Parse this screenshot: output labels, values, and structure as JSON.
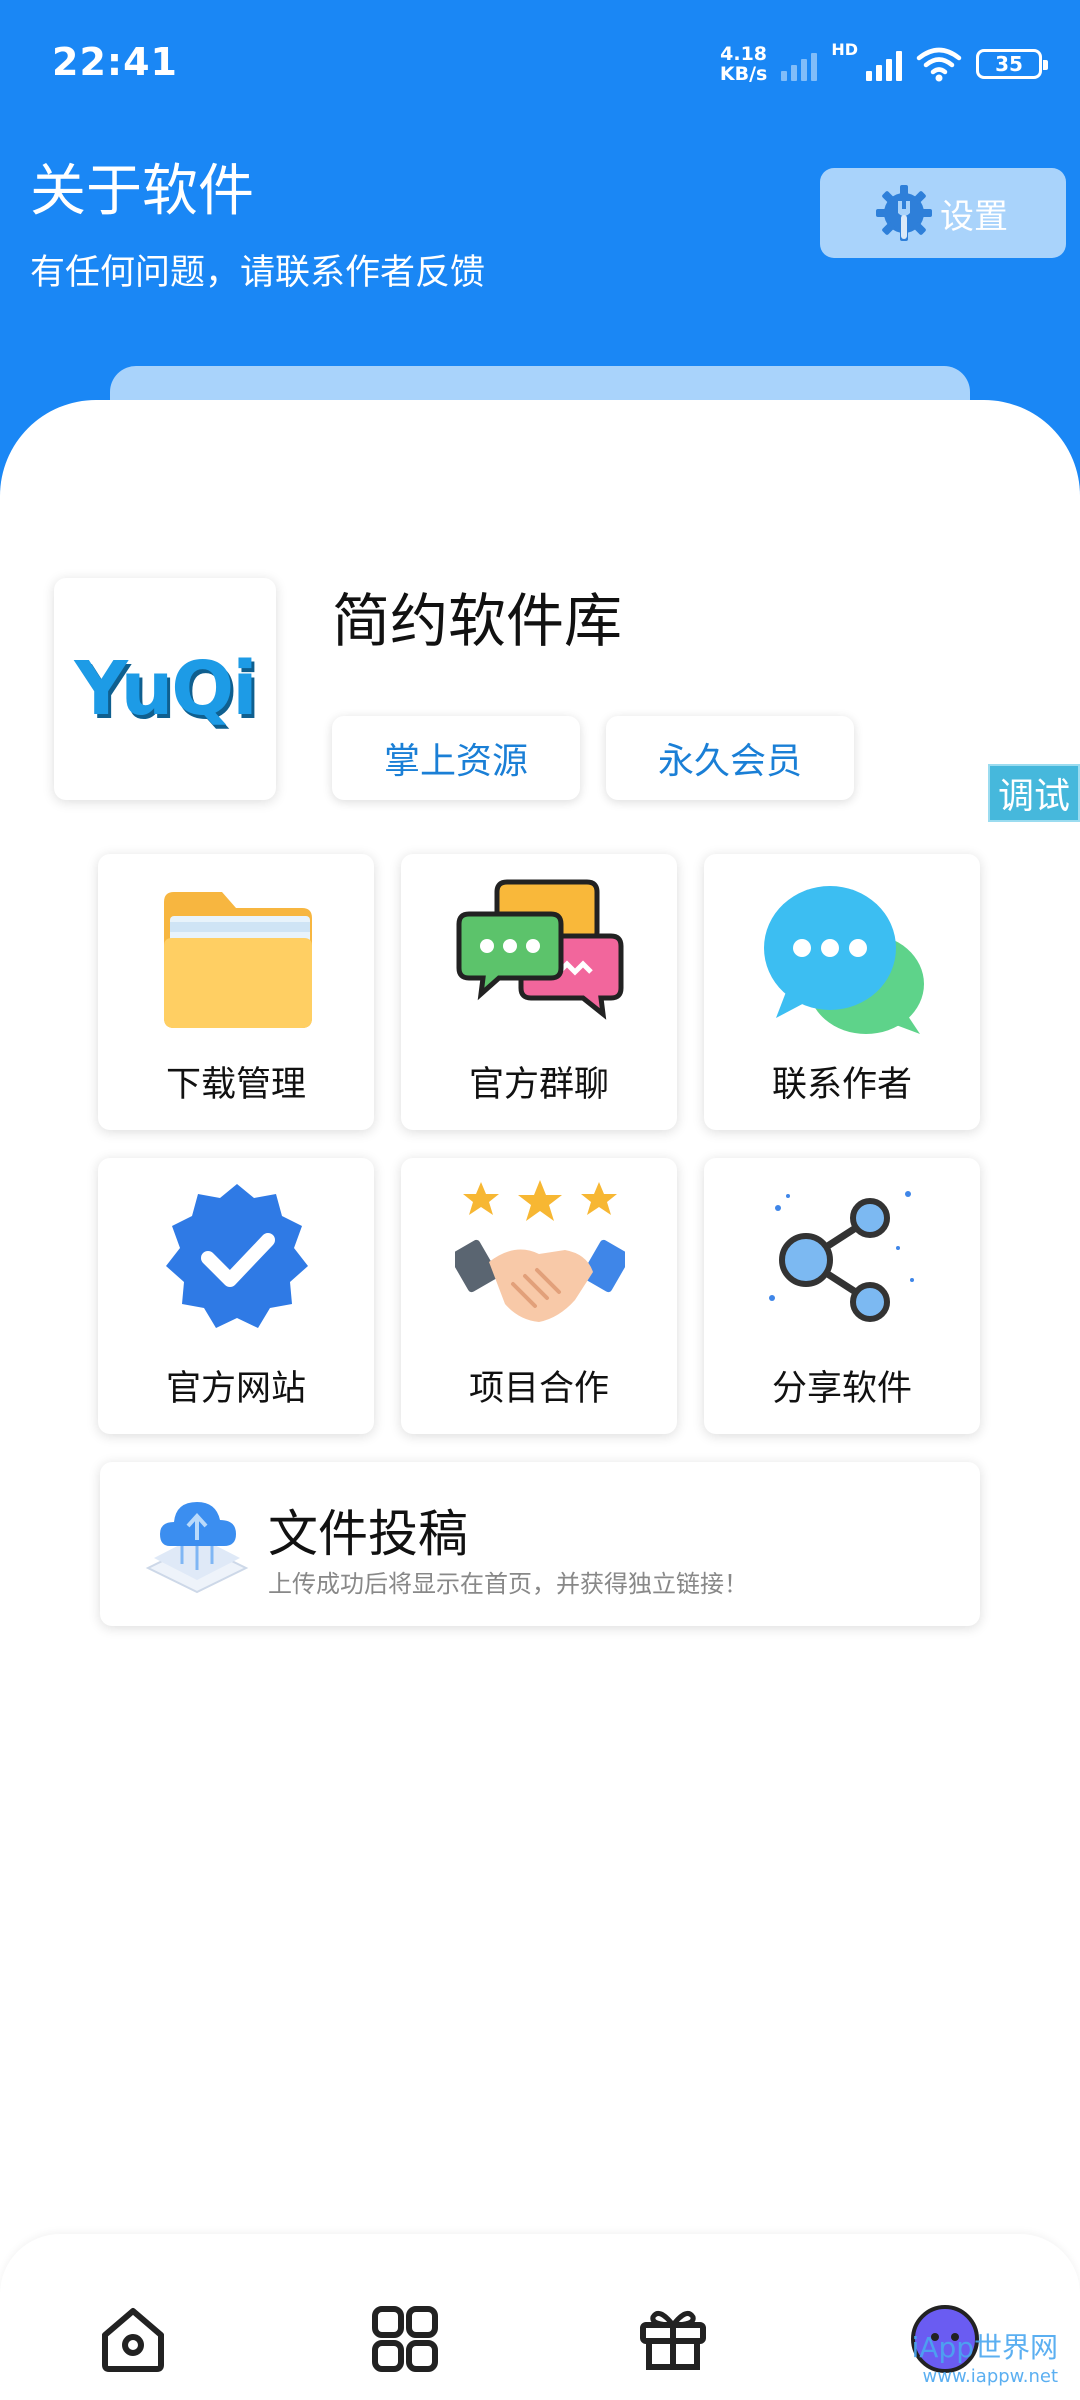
{
  "status_bar": {
    "time": "22:41",
    "net_speed_value": "4.18",
    "net_speed_unit": "KB/s",
    "network_badge": "HD",
    "battery": "35"
  },
  "header": {
    "title": "关于软件",
    "subtitle": "有任何问题，请联系作者反馈",
    "settings_label": "设置"
  },
  "app": {
    "logo_text": "YuQi",
    "name": "简约软件库",
    "tags": [
      "掌上资源",
      "永久会员"
    ]
  },
  "debug_label": "调试",
  "grid": [
    {
      "label": "下载管理",
      "icon": "folder-icon"
    },
    {
      "label": "官方群聊",
      "icon": "chat-group-icon"
    },
    {
      "label": "联系作者",
      "icon": "message-bubble-icon"
    },
    {
      "label": "官方网站",
      "icon": "verified-badge-icon"
    },
    {
      "label": "项目合作",
      "icon": "handshake-icon"
    },
    {
      "label": "分享软件",
      "icon": "share-icon"
    }
  ],
  "submit": {
    "title": "文件投稿",
    "description": "上传成功后将显示在首页，并获得独立链接！"
  },
  "bottom_nav": [
    "home-icon",
    "grid-icon",
    "gift-icon",
    "profile-icon"
  ],
  "watermark": {
    "line1": "iApp世界网",
    "line2": "www.iappw.net"
  },
  "colors": {
    "header_blue": "#1a87f5",
    "tag_text": "#1a7fd6",
    "debug_tag": "#46b8dc"
  }
}
